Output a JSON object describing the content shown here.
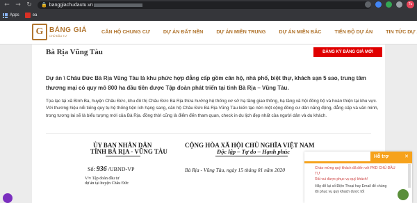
{
  "browser": {
    "url": "banggiachudautu.vn",
    "bookmarks": [
      {
        "label": "Apps",
        "icon": "apps-grid-icon"
      },
      {
        "label": "ea",
        "icon": "bookmark-favicon"
      }
    ],
    "profile_initials": "Tu"
  },
  "site": {
    "logo_text": "BẢNG GIÁ",
    "logo_subtext": "CHỦ ĐẦU TƯ",
    "nav": [
      "CĂN HỘ CHUNG CƯ",
      "DỰ ÁN ĐẤT NỀN",
      "DỰ ÁN MIỀN TRUNG",
      "DỰ ÁN MIỀN BẮC",
      "TIẾN ĐỘ DỰ ÁN",
      "TIN TỨC DỰ ÁN"
    ]
  },
  "page": {
    "title": "Bà Rịa Vũng Tàu",
    "register_button": "ĐĂNG KÝ BẢNG GIÁ MỚI",
    "lead": "Dự án \\          Châu Đức  Bà Rịa Vũng Tàu là khu phức hợp đẳng cấp gồm căn hộ, nhà phố, biệt thự, khách sạn 5 sao, trung tâm thương mại có quy mô 800 ha đầu tiên được Tập đoàn                    phát triển tại tỉnh Bà Rịa – Vũng Tàu.",
    "body": "Tọa lạc tại xã Bình Ba, huyện Châu Đức, khu đô thị                Châu Đức Bà Rịa  thừa hưởng hệ thống cơ sở hạ tầng giao thông, hạ tầng xã hội đồng bộ và hoàn thiện tại khu vực. Với thương hiệu nổi tiếng quy tụ hệ thống tiện ích hạng sang, căn hộ                Châu Đức Bà Rịa Vũng Tàu kiến tạo nên một cộng đồng cư dân năng động, đẳng cấp và văn minh, trong tương lai sẽ là biểu tượng mới của Bà Rịa. đồng thời cũng là điểm đến tham quan, check in du lịch đẹp nhất của người dân và du khách."
  },
  "document": {
    "left_line1": "ỦY BAN NHÂN DÂN",
    "left_line2": "TỈNH BÀ RỊA - VŨNG TÀU",
    "right_line1": "CỘNG HÒA XÃ HỘI CHỦ NGHĨA VIỆT NAM",
    "right_line2": "Độc lập – Tự do – Hạnh phúc",
    "number_prefix": "Số:",
    "number_value": "936",
    "number_suffix": "/UBND-VP",
    "date": "Bà Rịa - Vũng Tàu, ngày 15 tháng 01 năm 2020",
    "subject_line1": "V/v Tập đoàn                 đầu tư",
    "subject_line2": "dự án tại huyện Châu Đức"
  },
  "chat": {
    "header": "Hỗ trợ",
    "close_icon": "close-icon",
    "message": "Chào mừng quý khách đã đến với PKD CHỦ ĐẦU TƯ",
    "message_tail": "Rất vui được phục vụ quý khách!",
    "message2": "Hãy để lại số Điện Thoại hay Email để chúng tôi phục vụ quý khách được tốt"
  }
}
